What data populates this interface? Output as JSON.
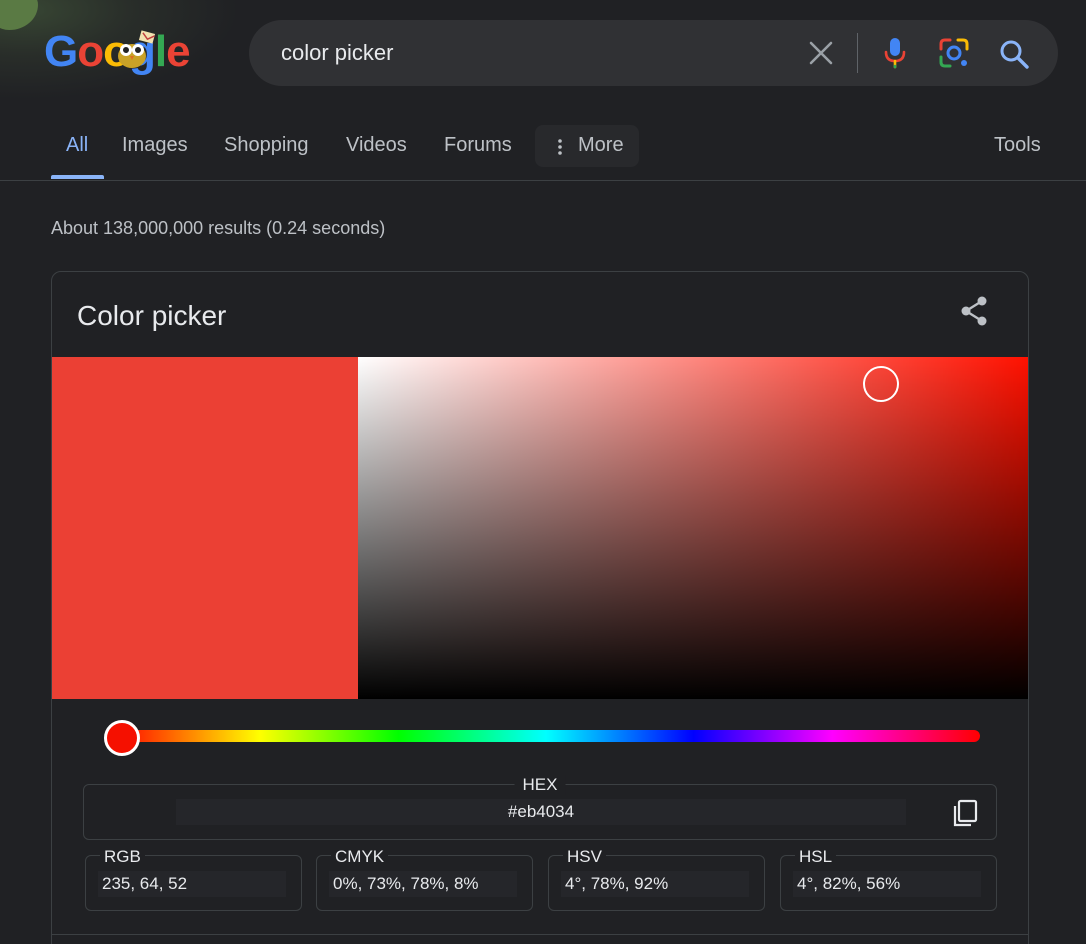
{
  "search": {
    "query": "color picker"
  },
  "logo": {
    "letters": [
      "G",
      "o",
      "o",
      "g",
      "l",
      "e"
    ],
    "colors": [
      "#4285f4",
      "#ea4335",
      "#fbbc05",
      "#4285f4",
      "#34a853",
      "#ea4335"
    ]
  },
  "tabs": {
    "items": [
      {
        "label": "All",
        "active": true
      },
      {
        "label": "Images"
      },
      {
        "label": "Shopping"
      },
      {
        "label": "Videos"
      },
      {
        "label": "Forums"
      }
    ],
    "more_label": "More",
    "tools_label": "Tools"
  },
  "stats": "About 138,000,000 results (0.24 seconds)",
  "card": {
    "title": "Color picker",
    "selected_color": "#eb4034",
    "hue_degrees": 4,
    "saturation": 0.78,
    "value": 0.92,
    "hex": {
      "label": "HEX",
      "value": "#eb4034"
    },
    "fields": [
      {
        "label": "RGB",
        "value": "235, 64, 52"
      },
      {
        "label": "CMYK",
        "value": "0%, 73%, 78%, 8%"
      },
      {
        "label": "HSV",
        "value": "4°, 78%, 92%"
      },
      {
        "label": "HSL",
        "value": "4°, 82%, 56%"
      }
    ]
  },
  "colors": {
    "background": "#202124",
    "accent": "#8ab4f8",
    "text": "#e8eaed",
    "muted": "#bdc1c6"
  }
}
